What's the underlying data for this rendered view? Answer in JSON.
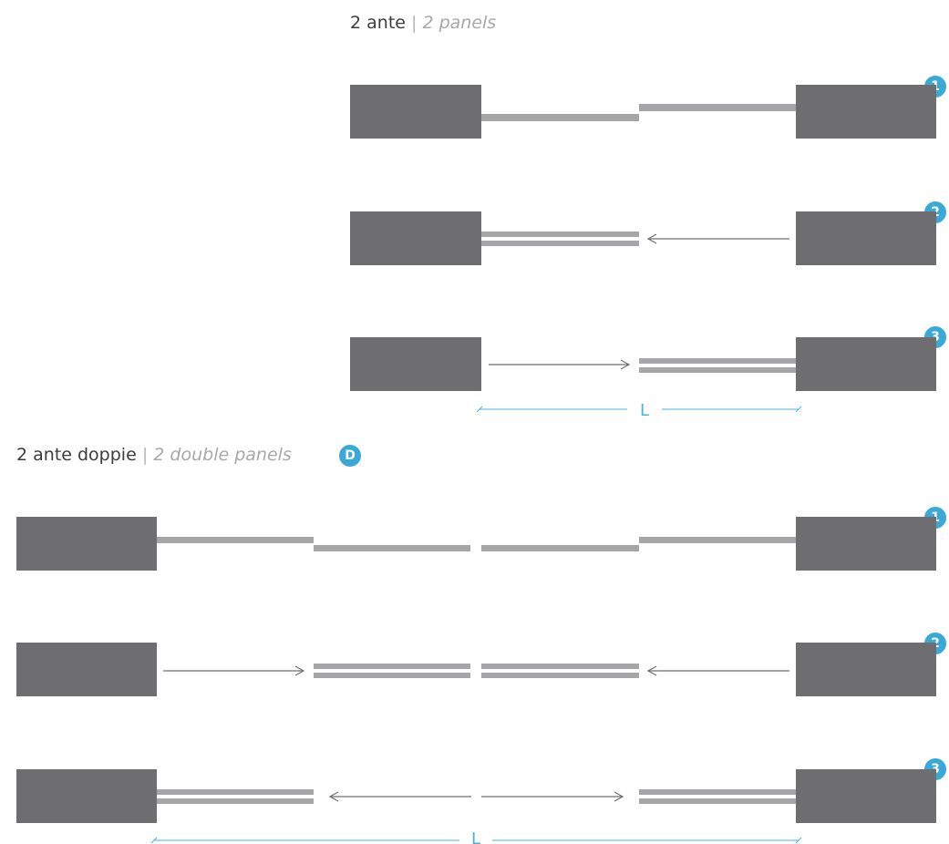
{
  "section_single": {
    "title_it": "2 ante",
    "title_sep": "|",
    "title_en": "2 panels",
    "badges": [
      "1",
      "2",
      "3"
    ],
    "dimension_label": "L"
  },
  "section_double": {
    "title_it": "2 ante doppie",
    "title_sep": "|",
    "title_en": "2 double panels",
    "marker": "D",
    "badges": [
      "1",
      "2",
      "3"
    ],
    "dimension_label": "L"
  },
  "colors": {
    "block": "#6e6e71",
    "panel": "#a6a6a8",
    "arrow": "#707072",
    "dimension": "#49b1dc",
    "badge": "#3aa9d6"
  }
}
